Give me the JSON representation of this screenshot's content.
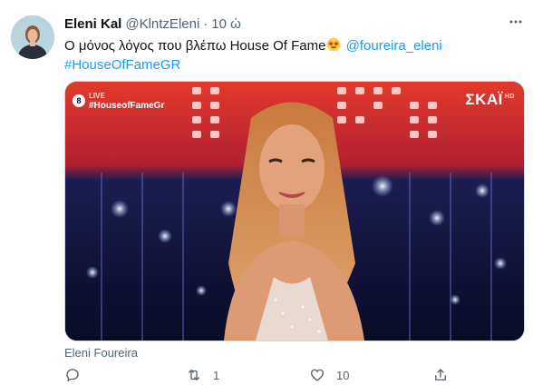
{
  "tweet": {
    "display_name": "Eleni Kal",
    "handle": "@KlntzEleni",
    "separator": "·",
    "time": "10 ώ",
    "text_before": "Ο μόνος λόγος που βλέπω House Of Fame",
    "mention": "@foureira_eleni",
    "hashtag": "#HouseOfFameGR",
    "media": {
      "live_label": "LIVE",
      "live_hashtag": "#HouseofFameGr",
      "live_number": "8",
      "channel_name": "ΣΚΑΪ",
      "channel_suffix": "HD"
    },
    "caption": "Eleni Foureira",
    "actions": {
      "reply_count": "",
      "retweet_count": "1",
      "like_count": "10"
    }
  },
  "icons": {
    "more": "more-horizontal-icon",
    "reply": "reply-icon",
    "retweet": "retweet-icon",
    "like": "heart-icon",
    "share": "share-icon",
    "emoji": "star-struck-emoji"
  },
  "colors": {
    "link": "#1d9bf0",
    "secondary": "#536471",
    "text": "#0f1419"
  }
}
